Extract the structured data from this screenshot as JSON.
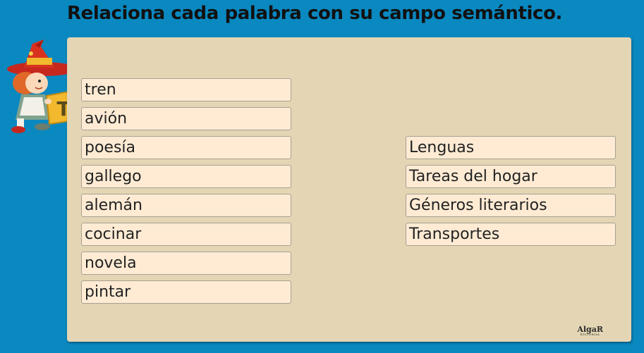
{
  "title": "Relaciona cada palabra con su campo semántico.",
  "words": [
    "tren",
    "avión",
    "poesía",
    "gallego",
    "alemán",
    "cocinar",
    "novela",
    "pintar"
  ],
  "categories": [
    "Lenguas",
    "Tareas del hogar",
    "Géneros literarios",
    "Transportes"
  ],
  "logo": {
    "name": "AlgaR",
    "sub": "EDITORIAL"
  },
  "mascot_letter": "T",
  "colors": {
    "background": "#0a88c0",
    "panel": "#e4d6b4",
    "item": "#ffebd4"
  }
}
